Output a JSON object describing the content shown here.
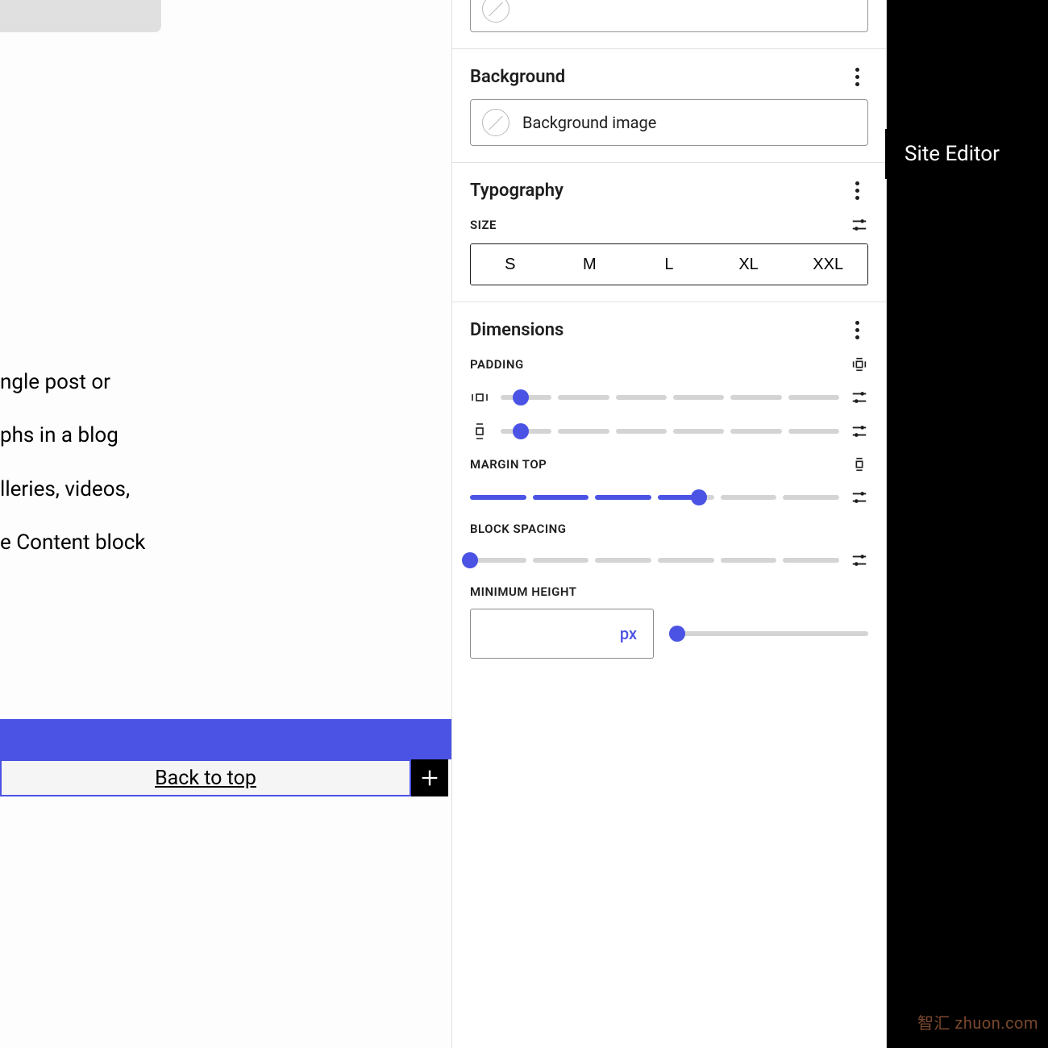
{
  "canvas": {
    "text_lines": [
      "ngle post or",
      "",
      "phs in a blog",
      "lleries, videos,",
      "",
      "e Content block"
    ],
    "back_to_top": "Back to top"
  },
  "tooltip": "Site Editor",
  "watermark": "智汇 zhuon.com",
  "panel": {
    "background": {
      "title": "Background",
      "image_label": "Background image"
    },
    "typography": {
      "title": "Typography",
      "size_label": "SIZE",
      "sizes": [
        "S",
        "M",
        "L",
        "XL",
        "XXL"
      ]
    },
    "dimensions": {
      "title": "Dimensions",
      "padding_label": "PADDING",
      "margin_top_label": "MARGIN TOP",
      "block_spacing_label": "BLOCK SPACING",
      "min_height_label": "MINIMUM HEIGHT",
      "unit": "px",
      "padding_h_pct": 6,
      "padding_v_pct": 6,
      "margin_top_pct": 62,
      "block_spacing_pct": 0,
      "min_height_pct": 3
    }
  }
}
